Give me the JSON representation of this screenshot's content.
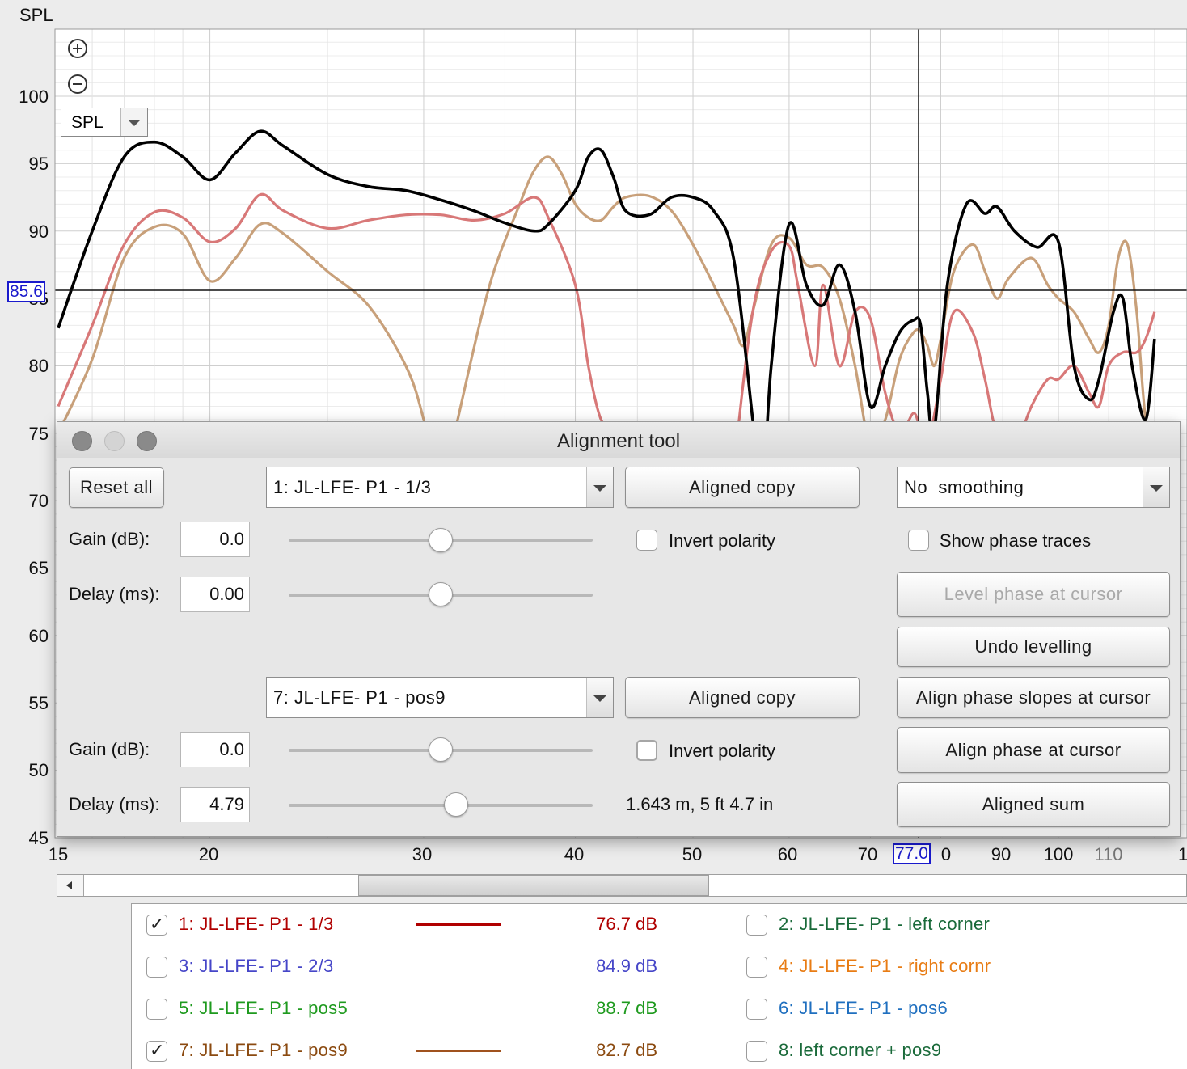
{
  "plot": {
    "y_axis_label": "SPL",
    "y_ticks": [
      "100",
      "95",
      "90",
      "85",
      "80",
      "75",
      "70",
      "65",
      "60",
      "55",
      "50",
      "45"
    ],
    "x_ticks": [
      "15",
      "20",
      "30",
      "40",
      "50",
      "60",
      "70",
      "0",
      "90",
      "100",
      "110",
      "1"
    ],
    "cursor": {
      "spl": "85.6",
      "freq": "77.0"
    },
    "view_select": "SPL",
    "colors": {
      "trace_1": "#d87878",
      "trace_7": "#c8a07a",
      "sum": "#000000",
      "grid": "#d9d9d9"
    }
  },
  "chart_data": {
    "type": "line",
    "xscale": "log",
    "ylim": [
      45,
      105
    ],
    "xlim": [
      15,
      120
    ],
    "series": [
      {
        "name": "7: JL-LFE- P1 - pos9",
        "color": "#c8a07a",
        "points": [
          [
            15,
            75
          ],
          [
            16,
            80.5
          ],
          [
            17,
            88
          ],
          [
            18,
            90.3
          ],
          [
            19,
            89.8
          ],
          [
            20,
            86.3
          ],
          [
            21,
            88
          ],
          [
            22,
            90.5
          ],
          [
            23,
            89.8
          ],
          [
            25,
            87
          ],
          [
            27,
            84.5
          ],
          [
            29,
            80
          ],
          [
            30,
            76
          ],
          [
            31,
            70
          ],
          [
            32,
            76
          ],
          [
            34,
            86
          ],
          [
            36,
            92
          ],
          [
            37,
            94.5
          ],
          [
            38,
            95.5
          ],
          [
            39,
            94.2
          ],
          [
            40,
            92
          ],
          [
            41,
            91
          ],
          [
            42,
            90.8
          ],
          [
            43,
            91.8
          ],
          [
            44,
            92.5
          ],
          [
            46,
            92.6
          ],
          [
            48,
            91.5
          ],
          [
            50,
            89
          ],
          [
            52,
            86
          ],
          [
            54,
            83
          ],
          [
            55,
            81.5
          ],
          [
            56,
            84
          ],
          [
            58,
            89
          ],
          [
            60,
            89.5
          ],
          [
            62,
            87.5
          ],
          [
            64,
            87.3
          ],
          [
            66,
            85
          ],
          [
            68,
            80
          ],
          [
            70,
            74
          ],
          [
            72,
            76
          ],
          [
            74,
            80.5
          ],
          [
            76,
            82.5
          ],
          [
            77,
            82.5
          ],
          [
            78,
            81.5
          ],
          [
            79,
            80
          ],
          [
            80,
            82
          ],
          [
            82,
            87
          ],
          [
            85,
            89
          ],
          [
            87,
            87
          ],
          [
            89,
            85
          ],
          [
            91,
            86.5
          ],
          [
            95,
            88
          ],
          [
            98,
            86
          ],
          [
            100,
            85
          ],
          [
            103,
            84
          ],
          [
            106,
            82
          ],
          [
            108,
            81
          ],
          [
            110,
            83
          ],
          [
            112,
            88
          ],
          [
            114,
            89
          ],
          [
            116,
            84
          ],
          [
            118,
            76
          ],
          [
            120,
            75
          ]
        ]
      },
      {
        "name": "1: JL-LFE- P1 - 1/3",
        "color": "#d87878",
        "points": [
          [
            15,
            77
          ],
          [
            16,
            83
          ],
          [
            17,
            89
          ],
          [
            18,
            91.4
          ],
          [
            19,
            91
          ],
          [
            20,
            89.2
          ],
          [
            21,
            90.2
          ],
          [
            22,
            92.7
          ],
          [
            23,
            91.5
          ],
          [
            25,
            90.2
          ],
          [
            27,
            90.8
          ],
          [
            29,
            91.2
          ],
          [
            31,
            91.2
          ],
          [
            33,
            90.8
          ],
          [
            35,
            91.3
          ],
          [
            37,
            92.5
          ],
          [
            38,
            91
          ],
          [
            40,
            86
          ],
          [
            41,
            80
          ],
          [
            42,
            76
          ],
          [
            43,
            75.5
          ],
          [
            44,
            72
          ],
          [
            46,
            70
          ],
          [
            48,
            67
          ],
          [
            50,
            60
          ],
          [
            52,
            55
          ],
          [
            54,
            72
          ],
          [
            56,
            84
          ],
          [
            58,
            88.5
          ],
          [
            60,
            88.9
          ],
          [
            61,
            86
          ],
          [
            63,
            80
          ],
          [
            64,
            86
          ],
          [
            66,
            80
          ],
          [
            68,
            84
          ],
          [
            70,
            83.5
          ],
          [
            72,
            78
          ],
          [
            74,
            75
          ],
          [
            76,
            76.5
          ],
          [
            77,
            75
          ],
          [
            78,
            74
          ],
          [
            80,
            79
          ],
          [
            82,
            84
          ],
          [
            85,
            82.5
          ],
          [
            87,
            79
          ],
          [
            89,
            75
          ],
          [
            92,
            74
          ],
          [
            95,
            77
          ],
          [
            98,
            79
          ],
          [
            100,
            79
          ],
          [
            103,
            80
          ],
          [
            106,
            78
          ],
          [
            108,
            77
          ],
          [
            110,
            80
          ],
          [
            113,
            81
          ],
          [
            116,
            81
          ],
          [
            118,
            82
          ],
          [
            120,
            84
          ]
        ]
      },
      {
        "name": "Aligned sum",
        "color": "#000000",
        "points": [
          [
            15,
            82.8
          ],
          [
            16,
            90
          ],
          [
            17,
            95.5
          ],
          [
            18,
            96.6
          ],
          [
            19,
            95.5
          ],
          [
            20,
            93.8
          ],
          [
            21,
            95.8
          ],
          [
            22,
            97.4
          ],
          [
            23,
            96.3
          ],
          [
            25,
            94.2
          ],
          [
            27,
            93.3
          ],
          [
            29,
            93
          ],
          [
            31,
            92.3
          ],
          [
            33,
            91.5
          ],
          [
            35,
            90.6
          ],
          [
            37,
            90
          ],
          [
            38,
            90.5
          ],
          [
            40,
            93
          ],
          [
            41,
            95.5
          ],
          [
            42,
            96
          ],
          [
            43,
            94
          ],
          [
            44,
            91.5
          ],
          [
            46,
            91.2
          ],
          [
            48,
            92.5
          ],
          [
            50,
            92.5
          ],
          [
            52,
            91.5
          ],
          [
            54,
            88
          ],
          [
            56,
            76
          ],
          [
            57,
            70
          ],
          [
            58,
            80
          ],
          [
            60,
            90.5
          ],
          [
            62,
            86
          ],
          [
            64,
            84.5
          ],
          [
            66,
            87.5
          ],
          [
            68,
            84
          ],
          [
            70,
            77
          ],
          [
            72,
            80
          ],
          [
            74,
            82.5
          ],
          [
            76,
            83.4
          ],
          [
            77,
            83
          ],
          [
            78,
            78
          ],
          [
            79,
            75
          ],
          [
            81,
            86
          ],
          [
            84,
            92
          ],
          [
            87,
            91.3
          ],
          [
            89,
            91.8
          ],
          [
            92,
            90
          ],
          [
            96,
            88.8
          ],
          [
            100,
            89.2
          ],
          [
            103,
            80
          ],
          [
            106,
            77.5
          ],
          [
            108,
            79
          ],
          [
            111,
            84
          ],
          [
            113,
            85
          ],
          [
            115,
            80
          ],
          [
            118,
            76
          ],
          [
            120,
            82
          ]
        ]
      }
    ]
  },
  "dialog": {
    "title": "Alignment tool",
    "reset_all": "Reset all",
    "top": {
      "measurement": "1: JL-LFE- P1 - 1/3",
      "aligned_copy": "Aligned copy",
      "gain_label": "Gain (dB):",
      "gain_value": "0.0",
      "gain_slider": 0.5,
      "delay_label": "Delay (ms):",
      "delay_value": "0.00",
      "delay_slider": 0.5,
      "invert_polarity": "Invert polarity"
    },
    "bottom": {
      "measurement": "7: JL-LFE- P1 - pos9",
      "aligned_copy": "Aligned copy",
      "gain_label": "Gain (dB):",
      "gain_value": "0.0",
      "gain_slider": 0.5,
      "delay_label": "Delay (ms):",
      "delay_value": "4.79",
      "delay_slider": 0.55,
      "invert_polarity": "Invert polarity",
      "distance": "1.643 m, 5 ft 4.7 in"
    },
    "smoothing": "No  smoothing",
    "show_phase_traces": "Show phase traces",
    "level_phase": "Level phase at cursor",
    "undo_levelling": "Undo levelling",
    "align_slopes": "Align phase slopes at cursor",
    "align_phase": "Align phase at cursor",
    "aligned_sum": "Aligned sum"
  },
  "legend": {
    "items": [
      {
        "label": "1: JL-LFE- P1 - 1/3",
        "checked": true,
        "value": "76.7 dB",
        "color": "#b00000",
        "line_color": "#b00000",
        "checkmark": "✓"
      },
      {
        "label": "2: JL-LFE- P1 - left corner",
        "checked": false,
        "color": "#1a6a3a"
      },
      {
        "label": "3: JL-LFE- P1 - 2/3",
        "checked": false,
        "value": "84.9 dB",
        "color": "#4646c8"
      },
      {
        "label": "4: JL-LFE- P1 - right cornr",
        "checked": false,
        "color": "#e87c14"
      },
      {
        "label": "5: JL-LFE- P1 - pos5",
        "checked": false,
        "value": "88.7 dB",
        "color": "#1e9a1e"
      },
      {
        "label": "6: JL-LFE- P1 - pos6",
        "checked": false,
        "color": "#1f6fbf"
      },
      {
        "label": "7: JL-LFE- P1 - pos9",
        "checked": true,
        "value": "82.7 dB",
        "color": "#8b4a10",
        "line_color": "#a0521e",
        "checkmark": "✓"
      },
      {
        "label": "8: left corner + pos9",
        "checked": false,
        "color": "#1a6a3a"
      }
    ]
  }
}
